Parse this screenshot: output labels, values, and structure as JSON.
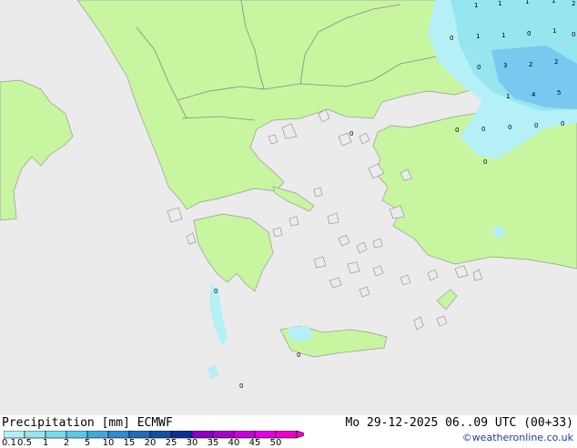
{
  "footer": {
    "title": "Precipitation [mm]  ECMWF",
    "datetime": "Mo 29-12-2025 06..09 UTC (00+33)",
    "credit": "©weatheronline.co.uk"
  },
  "legend": {
    "ticks": [
      "0.1",
      "0.5",
      "1",
      "2",
      "5",
      "10",
      "15",
      "20",
      "25",
      "30",
      "35",
      "40",
      "45",
      "50"
    ],
    "colors": [
      "#b4f0f5",
      "#96e6f0",
      "#78dcee",
      "#5ac8ea",
      "#41aadc",
      "#2d8ccc",
      "#1e6ebe",
      "#1450aa",
      "#0a3096",
      "#8a00c8",
      "#a800d2",
      "#c800dc",
      "#e000e6",
      "#f000c8"
    ]
  },
  "colors": {
    "sea": "#ebebeb",
    "land": "#c8f5a0",
    "coast": "#9a9a9a",
    "border": "#888888",
    "precip_light": "#b4f0f5",
    "precip_mid": "#96e6f0",
    "precip_heavy": "#78c8f0"
  },
  "values": [
    "1",
    "1",
    "1",
    "1",
    "2",
    "0",
    "1",
    "1",
    "0",
    "1",
    "0",
    "3",
    "2",
    "2",
    "1",
    "4",
    "5",
    "0",
    "0",
    "0",
    "0",
    "0",
    "0",
    "0",
    "0",
    "0",
    "0",
    "0"
  ]
}
